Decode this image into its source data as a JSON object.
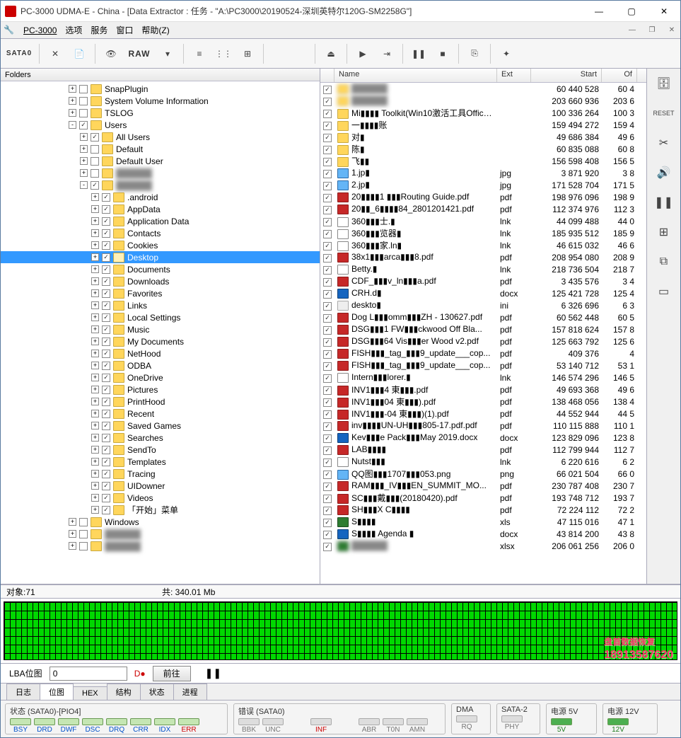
{
  "title": "PC-3000 UDMA-E - China - [Data Extractor : 任务 - \"A:\\PC3000\\20190524-深圳英特尔120G-SM2258G\"]",
  "menu": {
    "m0": "PC-3000",
    "m1": "选项",
    "m2": "服务",
    "m3": "窗口",
    "m4": "帮助(Z)"
  },
  "toolbar": {
    "sata": "SATA0",
    "raw": "RAW"
  },
  "folders_header": "Folders",
  "tree": [
    {
      "d": 6,
      "e": "+",
      "c": 0,
      "l": "SnapPlugin"
    },
    {
      "d": 6,
      "e": "+",
      "c": 0,
      "l": "System Volume Information"
    },
    {
      "d": 6,
      "e": "+",
      "c": 0,
      "l": "TSLOG"
    },
    {
      "d": 6,
      "e": "-",
      "c": 1,
      "l": "Users"
    },
    {
      "d": 7,
      "e": "+",
      "c": 1,
      "l": "All Users"
    },
    {
      "d": 7,
      "e": "+",
      "c": 0,
      "l": "Default"
    },
    {
      "d": 7,
      "e": "+",
      "c": 0,
      "l": "Default User"
    },
    {
      "d": 7,
      "e": "+",
      "c": 0,
      "l": "",
      "blur": 1
    },
    {
      "d": 7,
      "e": "-",
      "c": 1,
      "l": "",
      "blur": 1
    },
    {
      "d": 8,
      "e": "+",
      "c": 1,
      "l": ".android"
    },
    {
      "d": 8,
      "e": "+",
      "c": 1,
      "l": "AppData"
    },
    {
      "d": 8,
      "e": "+",
      "c": 1,
      "l": "Application Data"
    },
    {
      "d": 8,
      "e": "+",
      "c": 1,
      "l": "Contacts"
    },
    {
      "d": 8,
      "e": "+",
      "c": 1,
      "l": "Cookies"
    },
    {
      "d": 8,
      "e": "+",
      "c": 1,
      "l": "Desktop",
      "sel": 1,
      "open": 1
    },
    {
      "d": 8,
      "e": "+",
      "c": 1,
      "l": "Documents"
    },
    {
      "d": 8,
      "e": "+",
      "c": 1,
      "l": "Downloads"
    },
    {
      "d": 8,
      "e": "+",
      "c": 1,
      "l": "Favorites"
    },
    {
      "d": 8,
      "e": "+",
      "c": 1,
      "l": "Links"
    },
    {
      "d": 8,
      "e": "+",
      "c": 1,
      "l": "Local Settings"
    },
    {
      "d": 8,
      "e": "+",
      "c": 1,
      "l": "Music"
    },
    {
      "d": 8,
      "e": "+",
      "c": 1,
      "l": "My Documents"
    },
    {
      "d": 8,
      "e": "+",
      "c": 1,
      "l": "NetHood"
    },
    {
      "d": 8,
      "e": "+",
      "c": 1,
      "l": "ODBA"
    },
    {
      "d": 8,
      "e": "+",
      "c": 1,
      "l": "OneDrive"
    },
    {
      "d": 8,
      "e": "+",
      "c": 1,
      "l": "Pictures"
    },
    {
      "d": 8,
      "e": "+",
      "c": 1,
      "l": "PrintHood"
    },
    {
      "d": 8,
      "e": "+",
      "c": 1,
      "l": "Recent"
    },
    {
      "d": 8,
      "e": "+",
      "c": 1,
      "l": "Saved Games"
    },
    {
      "d": 8,
      "e": "+",
      "c": 1,
      "l": "Searches"
    },
    {
      "d": 8,
      "e": "+",
      "c": 1,
      "l": "SendTo"
    },
    {
      "d": 8,
      "e": "+",
      "c": 1,
      "l": "Templates"
    },
    {
      "d": 8,
      "e": "+",
      "c": 1,
      "l": "Tracing"
    },
    {
      "d": 8,
      "e": "+",
      "c": 1,
      "l": "UIDowner"
    },
    {
      "d": 8,
      "e": "+",
      "c": 1,
      "l": "Videos"
    },
    {
      "d": 8,
      "e": "+",
      "c": 1,
      "l": "「开始」菜单"
    },
    {
      "d": 6,
      "e": "+",
      "c": 0,
      "l": "Windows"
    },
    {
      "d": 6,
      "e": "+",
      "c": 0,
      "l": "",
      "blur": 1
    },
    {
      "d": 6,
      "e": "+",
      "c": 0,
      "l": "",
      "blur": 1
    }
  ],
  "grid": {
    "cols": {
      "c0": "Name",
      "c1": "Ext",
      "c2": "Start",
      "c3": "Of"
    },
    "rows": [
      {
        "i": "fld",
        "n": "",
        "e": "",
        "s": "60 440 528",
        "o": "60 4",
        "blur": 1
      },
      {
        "i": "fld",
        "n": "",
        "e": "",
        "s": "203 660 936",
        "o": "203 6",
        "blur": 1
      },
      {
        "i": "fld",
        "n": "Mi▮▮▮▮ Toolkit(Win10激活工具Office...",
        "e": "",
        "s": "100 336 264",
        "o": "100 3"
      },
      {
        "i": "fld",
        "n": "一▮▮▮▮账",
        "e": "",
        "s": "159 494 272",
        "o": "159 4"
      },
      {
        "i": "fld",
        "n": "对▮",
        "e": "",
        "s": "49 686 384",
        "o": "49 6"
      },
      {
        "i": "fld",
        "n": "陈▮",
        "e": "",
        "s": "60 835 088",
        "o": "60 8"
      },
      {
        "i": "fld",
        "n": "飞▮▮",
        "e": "",
        "s": "156 598 408",
        "o": "156 5"
      },
      {
        "i": "img",
        "n": "1.jp▮",
        "e": "jpg",
        "s": "3 871 920",
        "o": "3 8"
      },
      {
        "i": "img",
        "n": "2.jp▮",
        "e": "jpg",
        "s": "171 528 704",
        "o": "171 5"
      },
      {
        "i": "pdf",
        "n": "20▮▮▮▮1 ▮▮▮Routing Guide.pdf",
        "e": "pdf",
        "s": "198 976 096",
        "o": "198 9"
      },
      {
        "i": "pdf",
        "n": "20▮▮_6▮▮▮▮84_2801201421.pdf",
        "e": "pdf",
        "s": "112 374 976",
        "o": "112 3"
      },
      {
        "i": "lnk",
        "n": "360▮▮▮士.▮",
        "e": "lnk",
        "s": "44 099 488",
        "o": "44 0"
      },
      {
        "i": "lnk",
        "n": "360▮▮▮览器▮",
        "e": "lnk",
        "s": "185 935 512",
        "o": "185 9"
      },
      {
        "i": "lnk",
        "n": "360▮▮▮家.ln▮",
        "e": "lnk",
        "s": "46 615 032",
        "o": "46 6"
      },
      {
        "i": "pdf",
        "n": "38x1▮▮▮arca▮▮▮8.pdf",
        "e": "pdf",
        "s": "208 954 080",
        "o": "208 9"
      },
      {
        "i": "lnk",
        "n": "Betty.▮",
        "e": "lnk",
        "s": "218 736 504",
        "o": "218 7"
      },
      {
        "i": "pdf",
        "n": "CDF_▮▮▮v_ln▮▮▮a.pdf",
        "e": "pdf",
        "s": "3 435 576",
        "o": "3 4"
      },
      {
        "i": "doc",
        "n": "CRH.d▮",
        "e": "docx",
        "s": "125 421 728",
        "o": "125 4"
      },
      {
        "i": "ini",
        "n": "deskto▮",
        "e": "ini",
        "s": "6 326 696",
        "o": "6 3"
      },
      {
        "i": "pdf",
        "n": "Dog L▮▮▮omm▮▮▮ZH - 130627.pdf",
        "e": "pdf",
        "s": "60 562 448",
        "o": "60 5"
      },
      {
        "i": "pdf",
        "n": "DSG▮▮▮1 FW▮▮▮ckwood Off Bla...",
        "e": "pdf",
        "s": "157 818 624",
        "o": "157 8"
      },
      {
        "i": "pdf",
        "n": "DSG▮▮▮64 Vis▮▮▮er Wood v2.pdf",
        "e": "pdf",
        "s": "125 663 792",
        "o": "125 6"
      },
      {
        "i": "pdf",
        "n": "FISH▮▮▮_tag_▮▮▮9_update___cop...",
        "e": "pdf",
        "s": "409 376",
        "o": "4"
      },
      {
        "i": "pdf",
        "n": "FISH▮▮▮_tag_▮▮▮9_update___cop...",
        "e": "pdf",
        "s": "53 140 712",
        "o": "53 1"
      },
      {
        "i": "lnk",
        "n": "Intern▮▮▮lorer.▮",
        "e": "lnk",
        "s": "146 574 296",
        "o": "146 5"
      },
      {
        "i": "pdf",
        "n": "INV1▮▮▮4 東▮▮▮.pdf",
        "e": "pdf",
        "s": "49 693 368",
        "o": "49 6"
      },
      {
        "i": "pdf",
        "n": "INV1▮▮▮04 東▮▮▮).pdf",
        "e": "pdf",
        "s": "138 468 056",
        "o": "138 4"
      },
      {
        "i": "pdf",
        "n": "INV1▮▮▮-04 東▮▮▮)(1).pdf",
        "e": "pdf",
        "s": "44 552 944",
        "o": "44 5"
      },
      {
        "i": "pdf",
        "n": "inv▮▮▮▮UN-UH▮▮▮805-17.pdf.pdf",
        "e": "pdf",
        "s": "110 115 888",
        "o": "110 1"
      },
      {
        "i": "doc",
        "n": "Kev▮▮▮e Pack▮▮▮May 2019.docx",
        "e": "docx",
        "s": "123 829 096",
        "o": "123 8"
      },
      {
        "i": "pdf",
        "n": "LAB▮▮▮▮",
        "e": "pdf",
        "s": "112 799 944",
        "o": "112 7"
      },
      {
        "i": "lnk",
        "n": "Nutst▮▮▮",
        "e": "lnk",
        "s": "6 220 616",
        "o": "6 2"
      },
      {
        "i": "png",
        "n": "QQ图▮▮▮1707▮▮▮053.png",
        "e": "png",
        "s": "66 021 504",
        "o": "66 0"
      },
      {
        "i": "pdf",
        "n": "RAM▮▮▮_IV▮▮▮EN_SUMMIT_MO...",
        "e": "pdf",
        "s": "230 787 408",
        "o": "230 7"
      },
      {
        "i": "pdf",
        "n": "SC▮▮▮戴▮▮▮(20180420).pdf",
        "e": "pdf",
        "s": "193 748 712",
        "o": "193 7"
      },
      {
        "i": "pdf",
        "n": "SH▮▮▮X C▮▮▮▮",
        "e": "pdf",
        "s": "72 224 112",
        "o": "72 2"
      },
      {
        "i": "xls",
        "n": "S▮▮▮▮",
        "e": "xls",
        "s": "47 115 016",
        "o": "47 1"
      },
      {
        "i": "doc",
        "n": "S▮▮▮▮ Agenda ▮",
        "e": "docx",
        "s": "43 814 200",
        "o": "43 8"
      },
      {
        "i": "xls",
        "n": "",
        "e": "xlsx",
        "s": "206 061 256",
        "o": "206 0",
        "blur": 1
      }
    ]
  },
  "status": {
    "left": "对象:71",
    "mid": "共:   340.01 Mb"
  },
  "watermark": {
    "line1": "盘首数据恢复",
    "line2": "18913587620"
  },
  "lba": {
    "label": "LBA位图",
    "value": "0",
    "go": "前往"
  },
  "tabs": {
    "t0": "日志",
    "t1": "位图",
    "t2": "HEX",
    "t3": "结构",
    "t4": "状态",
    "t5": "进程"
  },
  "panel": {
    "g1": "状态 (SATA0)-[PIO4]",
    "g2": "错误 (SATA0)",
    "g3": "DMA",
    "g4": "SATA-2",
    "g5": "电源 5V",
    "g6": "电源 12V",
    "s": {
      "bsy": "BSY",
      "drd": "DRD",
      "dwf": "DWF",
      "dsc": "DSC",
      "drq": "DRQ",
      "crr": "CRR",
      "idx": "IDX",
      "err": "ERR",
      "bbk": "BBK",
      "unc": "UNC",
      "inf": "INF",
      "abr": "ABR",
      "ton": "T0N",
      "amn": "AMN",
      "rq": "RQ",
      "phy": "PHY",
      "v5": "5V",
      "v12": "12V"
    }
  }
}
